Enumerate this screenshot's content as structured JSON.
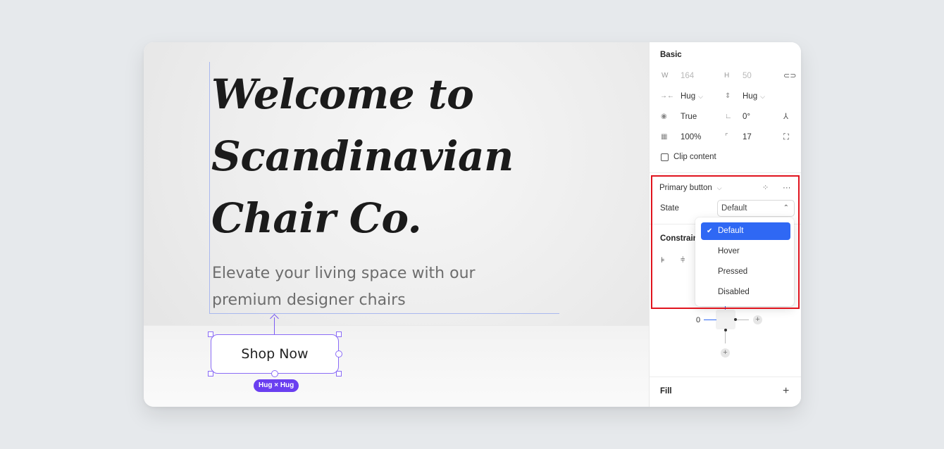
{
  "canvas": {
    "heading_lines": [
      "Welcome to",
      "Scandinavian",
      "Chair Co."
    ],
    "subtitle_lines": [
      "Elevate your living space with our",
      "premium designer chairs"
    ],
    "button_label": "Shop Now",
    "sizing_badge": "Hug × Hug"
  },
  "panel": {
    "basic": {
      "title": "Basic",
      "w_label": "W",
      "w_value": "164",
      "h_label": "H",
      "h_value": "50",
      "width_mode": "Hug",
      "height_mode": "Hug",
      "visible": "True",
      "rotation": "0°",
      "opacity": "100%",
      "radius": "17",
      "clip_content": "Clip content"
    },
    "component": {
      "name": "Primary button",
      "state_label": "State",
      "state_value": "Default",
      "options": [
        "Default",
        "Hover",
        "Pressed",
        "Disabled"
      ],
      "selected_option": "Default"
    },
    "constraints": {
      "title": "Constraints",
      "left_value": "0"
    },
    "fill": {
      "title": "Fill",
      "add": "+"
    }
  },
  "colors": {
    "selection": "#8b6cf7",
    "badge": "#6a3ff0",
    "dropdown_active": "#2f68f4",
    "highlight": "#e0141e"
  }
}
